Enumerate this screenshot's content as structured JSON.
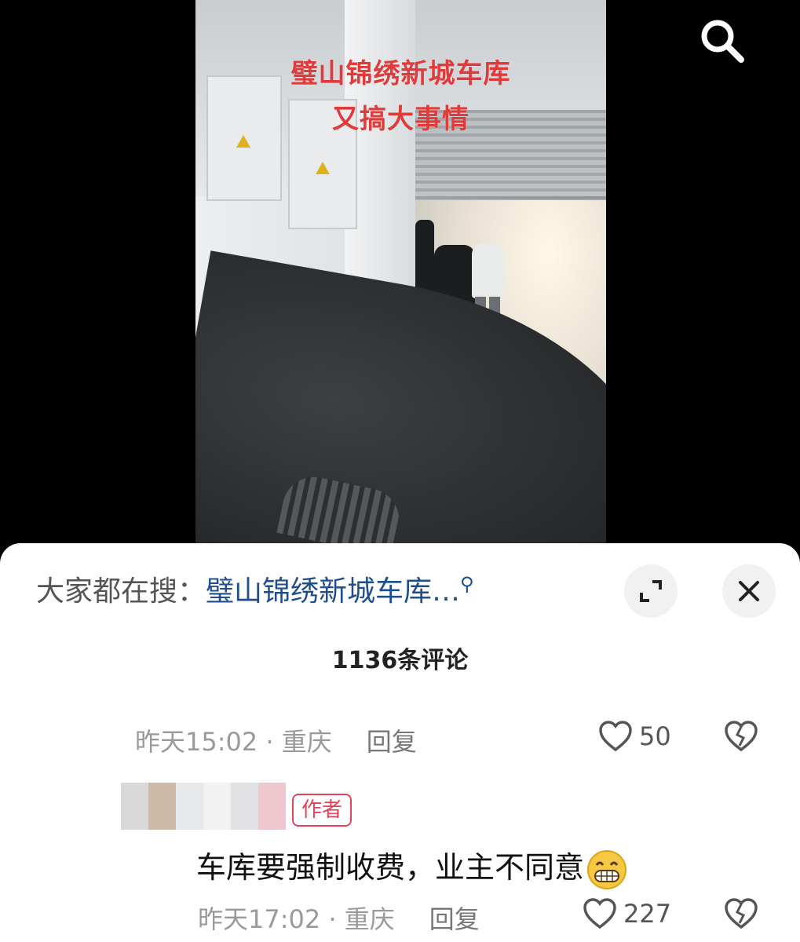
{
  "video": {
    "overlay_line1": "璧山锦绣新城车库",
    "overlay_line2": "又搞大事情",
    "search_icon": "search-icon"
  },
  "sheet": {
    "search_hint_prefix": "大家都在搜：",
    "search_hint_query": "璧山锦绣新城车库…",
    "comment_count": "1136条评论"
  },
  "comments": [
    {
      "time": "昨天15:02",
      "location": "重庆",
      "reply_label": "回复",
      "likes": "50"
    },
    {
      "badge": "作者",
      "text": "车库要强制收费，业主不同意",
      "time": "昨天17:02",
      "location": "重庆",
      "reply_label": "回复",
      "likes": "227"
    }
  ],
  "colors": {
    "overlay_text": "#e03a3a",
    "link": "#1e4f8c",
    "author_badge": "#e8405a"
  }
}
